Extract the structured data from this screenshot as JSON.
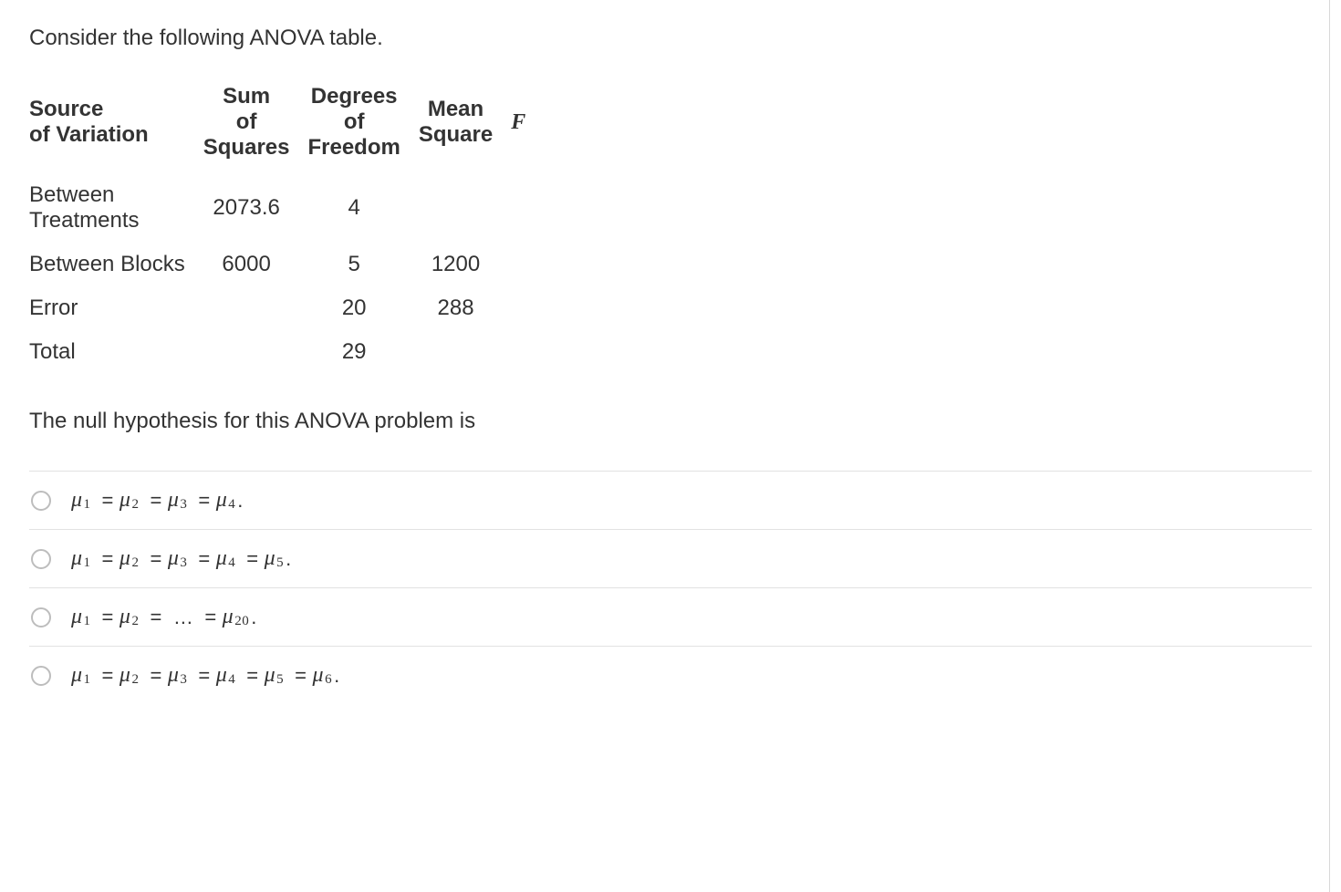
{
  "intro": "Consider the following ANOVA table.",
  "table": {
    "headers": {
      "source": "Source of Variation",
      "ss": "Sum of Squares",
      "df": "Degrees of Freedom",
      "ms": "Mean Square",
      "f": "F"
    },
    "rows": [
      {
        "source": "Between Treatments",
        "ss": "2073.6",
        "df": "4",
        "ms": "",
        "f": ""
      },
      {
        "source": "Between Blocks",
        "ss": "6000",
        "df": "5",
        "ms": "1200",
        "f": ""
      },
      {
        "source": "Error",
        "ss": "",
        "df": "20",
        "ms": "288",
        "f": ""
      },
      {
        "source": "Total",
        "ss": "",
        "df": "29",
        "ms": "",
        "f": ""
      }
    ]
  },
  "question": "The null hypothesis for this ANOVA problem is",
  "symbols": {
    "mu": "μ",
    "eq": "=",
    "ellipsis": "…"
  },
  "options": [
    {
      "type": "list",
      "subs": [
        "1",
        "2",
        "3",
        "4"
      ]
    },
    {
      "type": "list",
      "subs": [
        "1",
        "2",
        "3",
        "4",
        "5"
      ]
    },
    {
      "type": "ellipsis",
      "first": [
        "1",
        "2"
      ],
      "last": "20"
    },
    {
      "type": "list",
      "subs": [
        "1",
        "2",
        "3",
        "4",
        "5",
        "6"
      ]
    }
  ],
  "chart_data": {
    "type": "table",
    "title": "ANOVA Table",
    "columns": [
      "Source of Variation",
      "Sum of Squares",
      "Degrees of Freedom",
      "Mean Square",
      "F"
    ],
    "rows": [
      [
        "Between Treatments",
        2073.6,
        4,
        null,
        null
      ],
      [
        "Between Blocks",
        6000,
        5,
        1200,
        null
      ],
      [
        "Error",
        null,
        20,
        288,
        null
      ],
      [
        "Total",
        null,
        29,
        null,
        null
      ]
    ]
  }
}
